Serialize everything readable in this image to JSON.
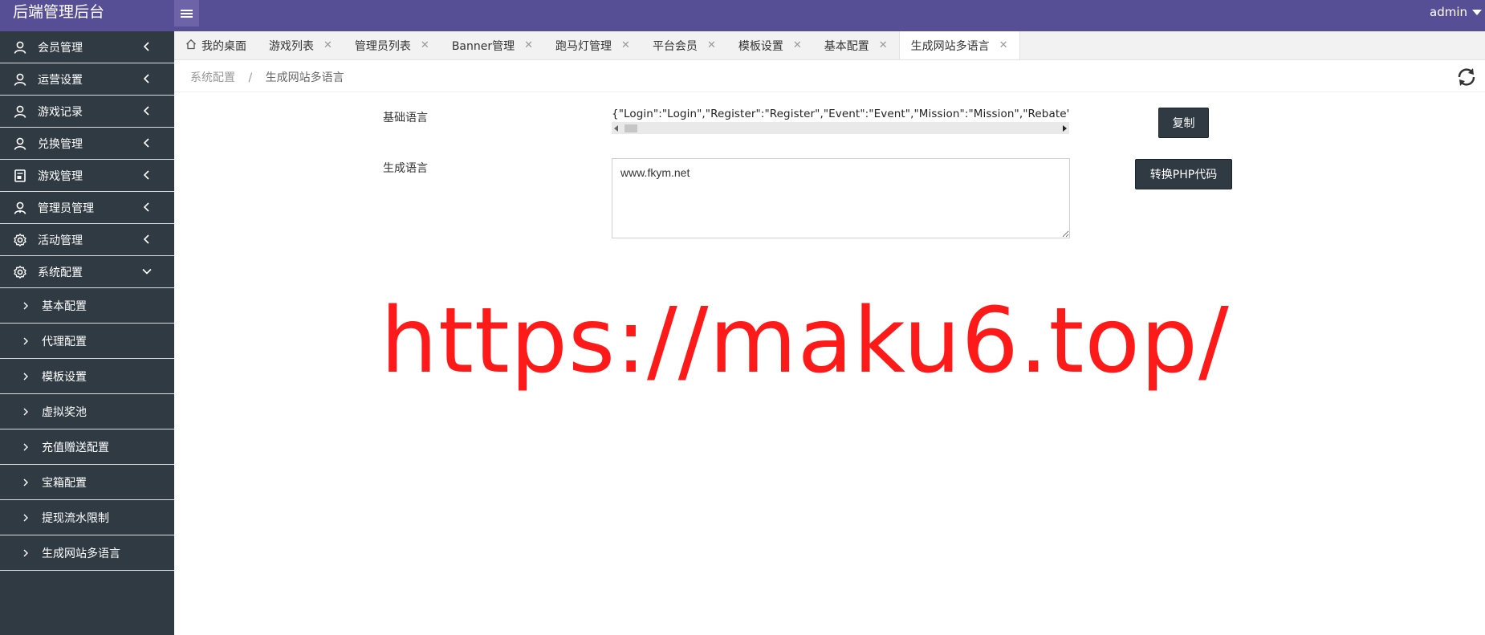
{
  "header": {
    "brand": "后端管理后台",
    "user": "admin"
  },
  "sidebar": {
    "items": [
      {
        "label": "会员管理",
        "icon": "user-icon"
      },
      {
        "label": "运营设置",
        "icon": "user-icon"
      },
      {
        "label": "游戏记录",
        "icon": "user-icon"
      },
      {
        "label": "兑换管理",
        "icon": "user-icon"
      },
      {
        "label": "游戏管理",
        "icon": "document-icon"
      },
      {
        "label": "管理员管理",
        "icon": "admin-user-icon"
      },
      {
        "label": "活动管理",
        "icon": "gear-icon"
      },
      {
        "label": "系统配置",
        "icon": "gear-icon"
      }
    ],
    "subitems": [
      "基本配置",
      "代理配置",
      "模板设置",
      "虚拟奖池",
      "充值赠送配置",
      "宝箱配置",
      "提现流水限制",
      "生成网站多语言"
    ]
  },
  "tabs": [
    {
      "label": "我的桌面",
      "closable": false
    },
    {
      "label": "游戏列表",
      "closable": true
    },
    {
      "label": "管理员列表",
      "closable": true
    },
    {
      "label": "Banner管理",
      "closable": true
    },
    {
      "label": "跑马灯管理",
      "closable": true
    },
    {
      "label": "平台会员",
      "closable": true
    },
    {
      "label": "模板设置",
      "closable": true
    },
    {
      "label": "基本配置",
      "closable": true
    },
    {
      "label": "生成网站多语言",
      "closable": true,
      "active": true
    }
  ],
  "breadcrumb": {
    "parent": "系统配置",
    "separator": "/",
    "current": "生成网站多语言"
  },
  "form": {
    "base_label": "基础语言",
    "base_value": "{\"Login\":\"Login\",\"Register\":\"Register\",\"Event\":\"Event\",\"Mission\":\"Mission\",\"Rebate\":\"Rebate\"",
    "gen_label": "生成语言",
    "gen_value": "www.fkym.net",
    "copy_button": "复制",
    "convert_button": "转换PHP代码"
  },
  "watermark": "https://maku6.top/",
  "colors": {
    "header": "#574f95",
    "sidebar": "#2f3a42",
    "button": "#2f3a42",
    "watermark": "#ff1a1a"
  }
}
